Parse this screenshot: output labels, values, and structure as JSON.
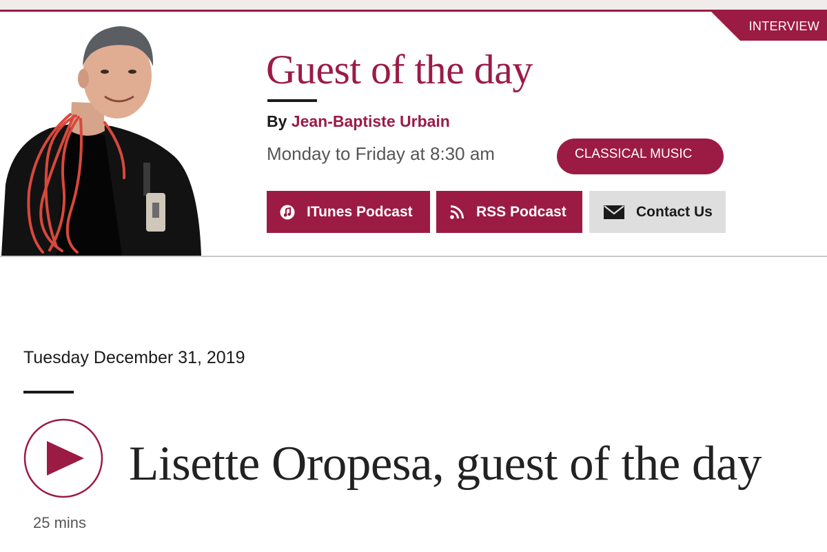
{
  "header": {
    "category_tag": "INTERVIEW",
    "show_title": "Guest of the day",
    "byline_prefix": "By",
    "host_name": "Jean-Baptiste Urbain",
    "schedule": "Monday to Friday at 8:30 am",
    "genre": "CLASSICAL MUSIC",
    "host_photo_icon": "host-portrait"
  },
  "buttons": {
    "itunes": {
      "label": "ITunes Podcast",
      "icon": "music-note-icon"
    },
    "rss": {
      "label": "RSS Podcast",
      "icon": "rss-icon"
    },
    "contact": {
      "label": "Contact Us",
      "icon": "envelope-icon"
    }
  },
  "episode": {
    "date": "Tuesday December 31, 2019",
    "title": "Lisette Oropesa, guest of the day",
    "duration": "25 mins",
    "play_icon": "play-icon"
  },
  "colors": {
    "accent": "#9b1b45",
    "text": "#1a1a1a",
    "muted": "#555555",
    "button_light": "#dedede"
  }
}
